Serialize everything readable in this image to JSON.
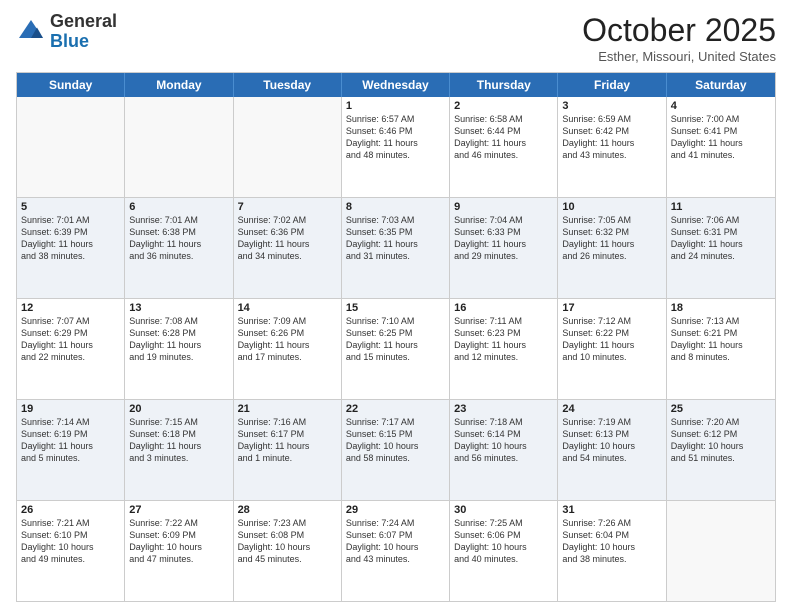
{
  "header": {
    "logo_general": "General",
    "logo_blue": "Blue",
    "month_title": "October 2025",
    "subtitle": "Esther, Missouri, United States"
  },
  "weekdays": [
    "Sunday",
    "Monday",
    "Tuesday",
    "Wednesday",
    "Thursday",
    "Friday",
    "Saturday"
  ],
  "rows": [
    [
      {
        "day": "",
        "info": "",
        "empty": true
      },
      {
        "day": "",
        "info": "",
        "empty": true
      },
      {
        "day": "",
        "info": "",
        "empty": true
      },
      {
        "day": "1",
        "info": "Sunrise: 6:57 AM\nSunset: 6:46 PM\nDaylight: 11 hours\nand 48 minutes.",
        "empty": false
      },
      {
        "day": "2",
        "info": "Sunrise: 6:58 AM\nSunset: 6:44 PM\nDaylight: 11 hours\nand 46 minutes.",
        "empty": false
      },
      {
        "day": "3",
        "info": "Sunrise: 6:59 AM\nSunset: 6:42 PM\nDaylight: 11 hours\nand 43 minutes.",
        "empty": false
      },
      {
        "day": "4",
        "info": "Sunrise: 7:00 AM\nSunset: 6:41 PM\nDaylight: 11 hours\nand 41 minutes.",
        "empty": false
      }
    ],
    [
      {
        "day": "5",
        "info": "Sunrise: 7:01 AM\nSunset: 6:39 PM\nDaylight: 11 hours\nand 38 minutes.",
        "empty": false
      },
      {
        "day": "6",
        "info": "Sunrise: 7:01 AM\nSunset: 6:38 PM\nDaylight: 11 hours\nand 36 minutes.",
        "empty": false
      },
      {
        "day": "7",
        "info": "Sunrise: 7:02 AM\nSunset: 6:36 PM\nDaylight: 11 hours\nand 34 minutes.",
        "empty": false
      },
      {
        "day": "8",
        "info": "Sunrise: 7:03 AM\nSunset: 6:35 PM\nDaylight: 11 hours\nand 31 minutes.",
        "empty": false
      },
      {
        "day": "9",
        "info": "Sunrise: 7:04 AM\nSunset: 6:33 PM\nDaylight: 11 hours\nand 29 minutes.",
        "empty": false
      },
      {
        "day": "10",
        "info": "Sunrise: 7:05 AM\nSunset: 6:32 PM\nDaylight: 11 hours\nand 26 minutes.",
        "empty": false
      },
      {
        "day": "11",
        "info": "Sunrise: 7:06 AM\nSunset: 6:31 PM\nDaylight: 11 hours\nand 24 minutes.",
        "empty": false
      }
    ],
    [
      {
        "day": "12",
        "info": "Sunrise: 7:07 AM\nSunset: 6:29 PM\nDaylight: 11 hours\nand 22 minutes.",
        "empty": false
      },
      {
        "day": "13",
        "info": "Sunrise: 7:08 AM\nSunset: 6:28 PM\nDaylight: 11 hours\nand 19 minutes.",
        "empty": false
      },
      {
        "day": "14",
        "info": "Sunrise: 7:09 AM\nSunset: 6:26 PM\nDaylight: 11 hours\nand 17 minutes.",
        "empty": false
      },
      {
        "day": "15",
        "info": "Sunrise: 7:10 AM\nSunset: 6:25 PM\nDaylight: 11 hours\nand 15 minutes.",
        "empty": false
      },
      {
        "day": "16",
        "info": "Sunrise: 7:11 AM\nSunset: 6:23 PM\nDaylight: 11 hours\nand 12 minutes.",
        "empty": false
      },
      {
        "day": "17",
        "info": "Sunrise: 7:12 AM\nSunset: 6:22 PM\nDaylight: 11 hours\nand 10 minutes.",
        "empty": false
      },
      {
        "day": "18",
        "info": "Sunrise: 7:13 AM\nSunset: 6:21 PM\nDaylight: 11 hours\nand 8 minutes.",
        "empty": false
      }
    ],
    [
      {
        "day": "19",
        "info": "Sunrise: 7:14 AM\nSunset: 6:19 PM\nDaylight: 11 hours\nand 5 minutes.",
        "empty": false
      },
      {
        "day": "20",
        "info": "Sunrise: 7:15 AM\nSunset: 6:18 PM\nDaylight: 11 hours\nand 3 minutes.",
        "empty": false
      },
      {
        "day": "21",
        "info": "Sunrise: 7:16 AM\nSunset: 6:17 PM\nDaylight: 11 hours\nand 1 minute.",
        "empty": false
      },
      {
        "day": "22",
        "info": "Sunrise: 7:17 AM\nSunset: 6:15 PM\nDaylight: 10 hours\nand 58 minutes.",
        "empty": false
      },
      {
        "day": "23",
        "info": "Sunrise: 7:18 AM\nSunset: 6:14 PM\nDaylight: 10 hours\nand 56 minutes.",
        "empty": false
      },
      {
        "day": "24",
        "info": "Sunrise: 7:19 AM\nSunset: 6:13 PM\nDaylight: 10 hours\nand 54 minutes.",
        "empty": false
      },
      {
        "day": "25",
        "info": "Sunrise: 7:20 AM\nSunset: 6:12 PM\nDaylight: 10 hours\nand 51 minutes.",
        "empty": false
      }
    ],
    [
      {
        "day": "26",
        "info": "Sunrise: 7:21 AM\nSunset: 6:10 PM\nDaylight: 10 hours\nand 49 minutes.",
        "empty": false
      },
      {
        "day": "27",
        "info": "Sunrise: 7:22 AM\nSunset: 6:09 PM\nDaylight: 10 hours\nand 47 minutes.",
        "empty": false
      },
      {
        "day": "28",
        "info": "Sunrise: 7:23 AM\nSunset: 6:08 PM\nDaylight: 10 hours\nand 45 minutes.",
        "empty": false
      },
      {
        "day": "29",
        "info": "Sunrise: 7:24 AM\nSunset: 6:07 PM\nDaylight: 10 hours\nand 43 minutes.",
        "empty": false
      },
      {
        "day": "30",
        "info": "Sunrise: 7:25 AM\nSunset: 6:06 PM\nDaylight: 10 hours\nand 40 minutes.",
        "empty": false
      },
      {
        "day": "31",
        "info": "Sunrise: 7:26 AM\nSunset: 6:04 PM\nDaylight: 10 hours\nand 38 minutes.",
        "empty": false
      },
      {
        "day": "",
        "info": "",
        "empty": true
      }
    ]
  ]
}
